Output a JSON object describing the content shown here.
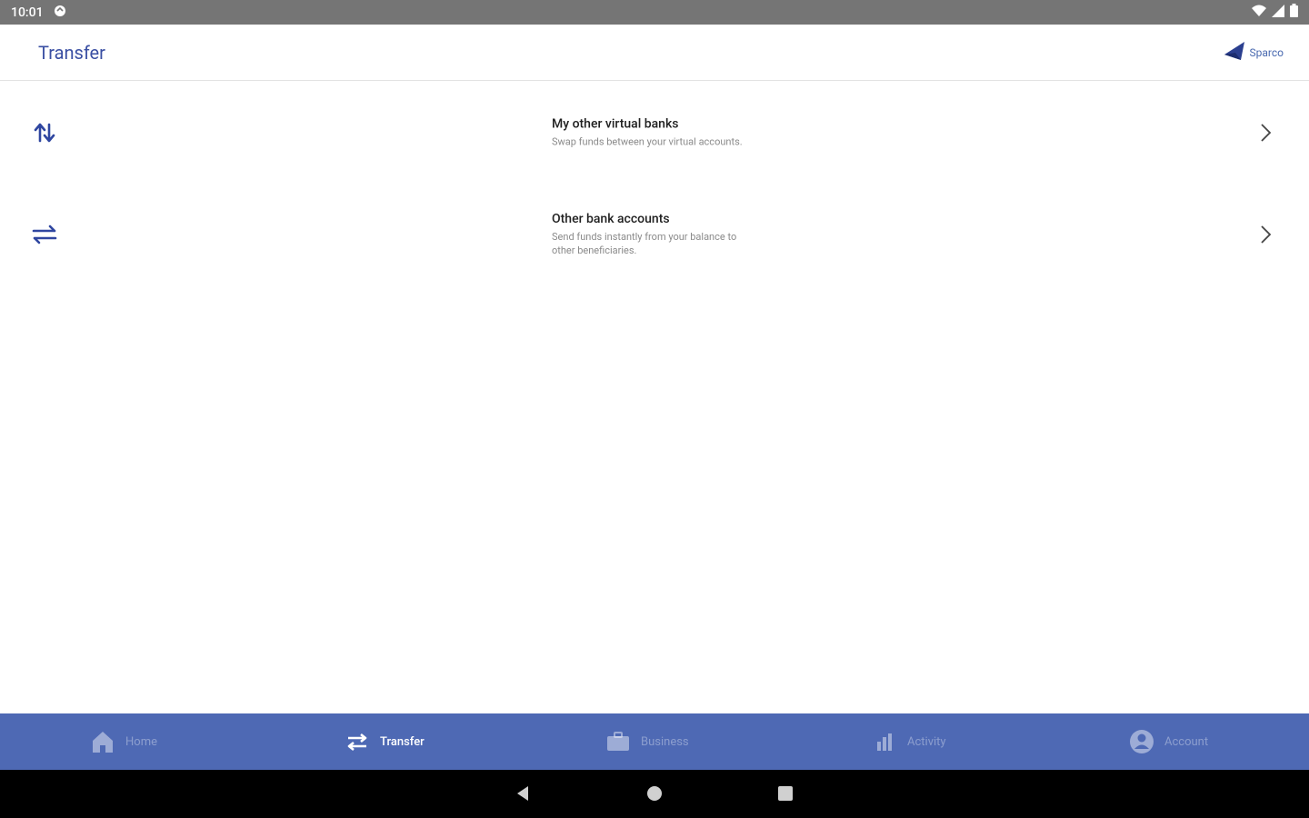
{
  "status_bar": {
    "time": "10:01"
  },
  "app_bar": {
    "title": "Transfer",
    "logo_text": "Sparco"
  },
  "transfer_options": [
    {
      "title": "My other virtual banks",
      "subtitle": "Swap funds between your virtual accounts.",
      "icon": "swap-vertical-icon"
    },
    {
      "title": "Other bank accounts",
      "subtitle": "Send funds instantly from your balance to other beneficiaries.",
      "icon": "swap-horizontal-icon"
    }
  ],
  "bottom_nav": {
    "items": [
      {
        "label": "Home",
        "icon": "home-icon",
        "active": false
      },
      {
        "label": "Transfer",
        "icon": "transfer-icon",
        "active": true
      },
      {
        "label": "Business",
        "icon": "briefcase-icon",
        "active": false
      },
      {
        "label": "Activity",
        "icon": "bar-chart-icon",
        "active": false
      },
      {
        "label": "Account",
        "icon": "account-icon",
        "active": false
      }
    ]
  },
  "colors": {
    "accent": "#3a4fa3",
    "nav_background": "#4e69b4",
    "status_bar": "#757575"
  }
}
